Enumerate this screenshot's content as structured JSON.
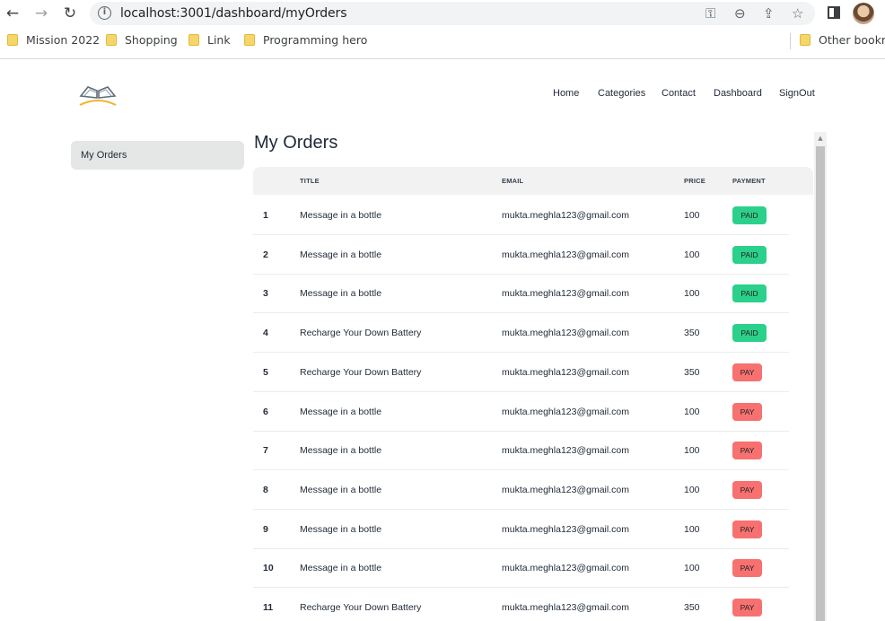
{
  "browser": {
    "url": "localhost:3001/dashboard/myOrders",
    "bookmarks": [
      "Mission 2022",
      "Shopping",
      "Link",
      "Programming hero"
    ],
    "other_bookmarks": "Other bookma"
  },
  "nav": {
    "home": "Home",
    "categories": "Categories",
    "contact": "Contact",
    "dashboard": "Dashboard",
    "signout": "SignOut"
  },
  "sidebar": {
    "my_orders": "My Orders"
  },
  "page_title": "My Orders",
  "table": {
    "headers": {
      "title": "TITLE",
      "email": "EMAIL",
      "price": "PRICE",
      "payment": "PAYMENT"
    },
    "rows": [
      {
        "num": "1",
        "title": "Message in a bottle",
        "email": "mukta.meghla123@gmail.com",
        "price": "100",
        "status": "PAID"
      },
      {
        "num": "2",
        "title": "Message in a bottle",
        "email": "mukta.meghla123@gmail.com",
        "price": "100",
        "status": "PAID"
      },
      {
        "num": "3",
        "title": "Message in a bottle",
        "email": "mukta.meghla123@gmail.com",
        "price": "100",
        "status": "PAID"
      },
      {
        "num": "4",
        "title": "Recharge Your Down Battery",
        "email": "mukta.meghla123@gmail.com",
        "price": "350",
        "status": "PAID"
      },
      {
        "num": "5",
        "title": "Recharge Your Down Battery",
        "email": "mukta.meghla123@gmail.com",
        "price": "350",
        "status": "PAY"
      },
      {
        "num": "6",
        "title": "Message in a bottle",
        "email": "mukta.meghla123@gmail.com",
        "price": "100",
        "status": "PAY"
      },
      {
        "num": "7",
        "title": "Message in a bottle",
        "email": "mukta.meghla123@gmail.com",
        "price": "100",
        "status": "PAY"
      },
      {
        "num": "8",
        "title": "Message in a bottle",
        "email": "mukta.meghla123@gmail.com",
        "price": "100",
        "status": "PAY"
      },
      {
        "num": "9",
        "title": "Message in a bottle",
        "email": "mukta.meghla123@gmail.com",
        "price": "100",
        "status": "PAY"
      },
      {
        "num": "10",
        "title": "Message in a bottle",
        "email": "mukta.meghla123@gmail.com",
        "price": "100",
        "status": "PAY"
      },
      {
        "num": "11",
        "title": "Recharge Your Down Battery",
        "email": "mukta.meghla123@gmail.com",
        "price": "350",
        "status": "PAY"
      }
    ]
  },
  "colors": {
    "paid": "#2bd18b",
    "pay": "#f87171"
  }
}
